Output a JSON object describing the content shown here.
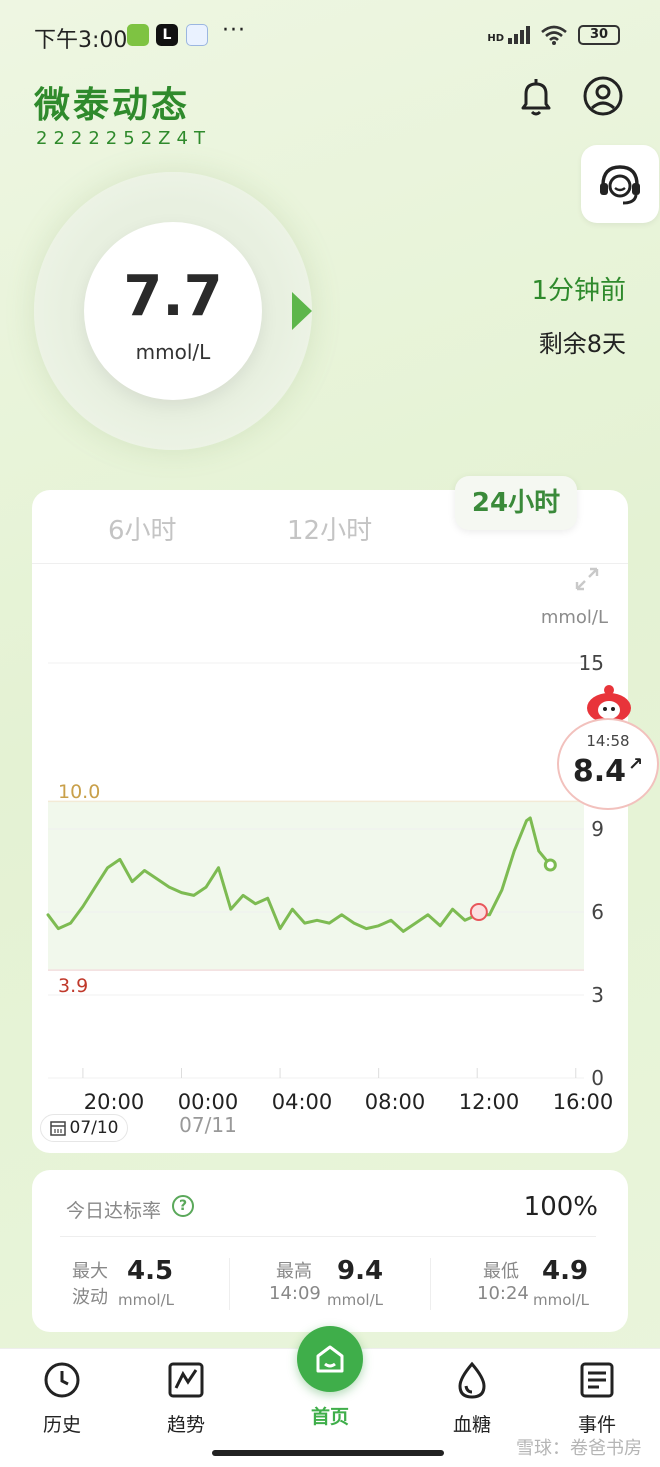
{
  "status_bar": {
    "time": "下午3:00",
    "more": "···",
    "signal_label": "HD",
    "battery": "30"
  },
  "header": {
    "title": "微泰动态",
    "device_id": "2222252Z4T"
  },
  "current": {
    "value": "7.7",
    "unit": "mmol/L",
    "last_update": "1分钟前",
    "remaining": "剩余8天"
  },
  "chart": {
    "tabs": [
      "6小时",
      "12小时",
      "24小时"
    ],
    "active_tab": "24小时",
    "y_unit": "mmol/L",
    "y_ticks": [
      "15",
      "9",
      "6",
      "3",
      "0"
    ],
    "x_ticks": [
      "20:00",
      "00:00",
      "04:00",
      "08:00",
      "12:00",
      "16:00"
    ],
    "x_date_label": "07/11",
    "start_date": "07/10",
    "high_limit": "10.0",
    "low_limit": "3.9",
    "latest_time": "14:58",
    "latest_value": "8.4",
    "latest_trend": "↗"
  },
  "chart_data": {
    "type": "line",
    "title": "",
    "xlabel": "",
    "ylabel": "mmol/L",
    "ylim": [
      0,
      15
    ],
    "x_ticks": [
      "20:00",
      "00:00",
      "04:00",
      "08:00",
      "12:00",
      "16:00"
    ],
    "target_range": [
      3.9,
      10.0
    ],
    "grid": true,
    "series": [
      {
        "color": "#7dbb52",
        "x": [
          "18:35",
          "19:00",
          "19:30",
          "20:00",
          "20:30",
          "21:00",
          "21:30",
          "22:00",
          "22:30",
          "23:00",
          "23:30",
          "00:00",
          "00:30",
          "01:00",
          "01:30",
          "02:00",
          "02:30",
          "03:00",
          "03:30",
          "04:00",
          "04:30",
          "05:00",
          "05:30",
          "06:00",
          "06:30",
          "07:00",
          "07:30",
          "08:00",
          "08:30",
          "09:00",
          "09:30",
          "10:00",
          "10:30",
          "11:00",
          "11:30",
          "12:00",
          "12:30",
          "13:00",
          "13:30",
          "14:00",
          "14:09",
          "14:30",
          "14:58"
        ],
        "y": [
          5.9,
          5.4,
          5.6,
          6.2,
          6.9,
          7.6,
          7.9,
          7.1,
          7.5,
          7.2,
          6.9,
          6.7,
          6.6,
          6.9,
          7.6,
          6.1,
          6.6,
          6.3,
          6.5,
          5.4,
          6.1,
          5.6,
          5.7,
          5.6,
          5.9,
          5.6,
          5.4,
          5.5,
          5.7,
          5.3,
          5.6,
          5.9,
          5.5,
          6.1,
          5.7,
          5.9,
          5.9,
          6.8,
          8.2,
          9.3,
          9.4,
          8.2,
          7.7
        ]
      }
    ]
  },
  "stats": {
    "label": "今日达标率",
    "help": "?",
    "percent": "100%",
    "fluct_l1": "最大",
    "fluct_l2": "波动",
    "fluct_value": "4.5",
    "fluct_unit": "mmol/L",
    "max_label": "最高",
    "max_time": "14:09",
    "max_value": "9.4",
    "max_unit": "mmol/L",
    "min_label": "最低",
    "min_time": "10:24",
    "min_value": "4.9",
    "min_unit": "mmol/L"
  },
  "nav": {
    "history": "历史",
    "trend": "趋势",
    "home": "首页",
    "glucose": "血糖",
    "events": "事件"
  },
  "watermark": "雪球：卷爸书房",
  "colors": {
    "brand_green": "#2f8a2c",
    "line": "#7dbb52",
    "high": "#c9a04a",
    "low": "#c0392b",
    "nav_active": "#3fae4a"
  }
}
